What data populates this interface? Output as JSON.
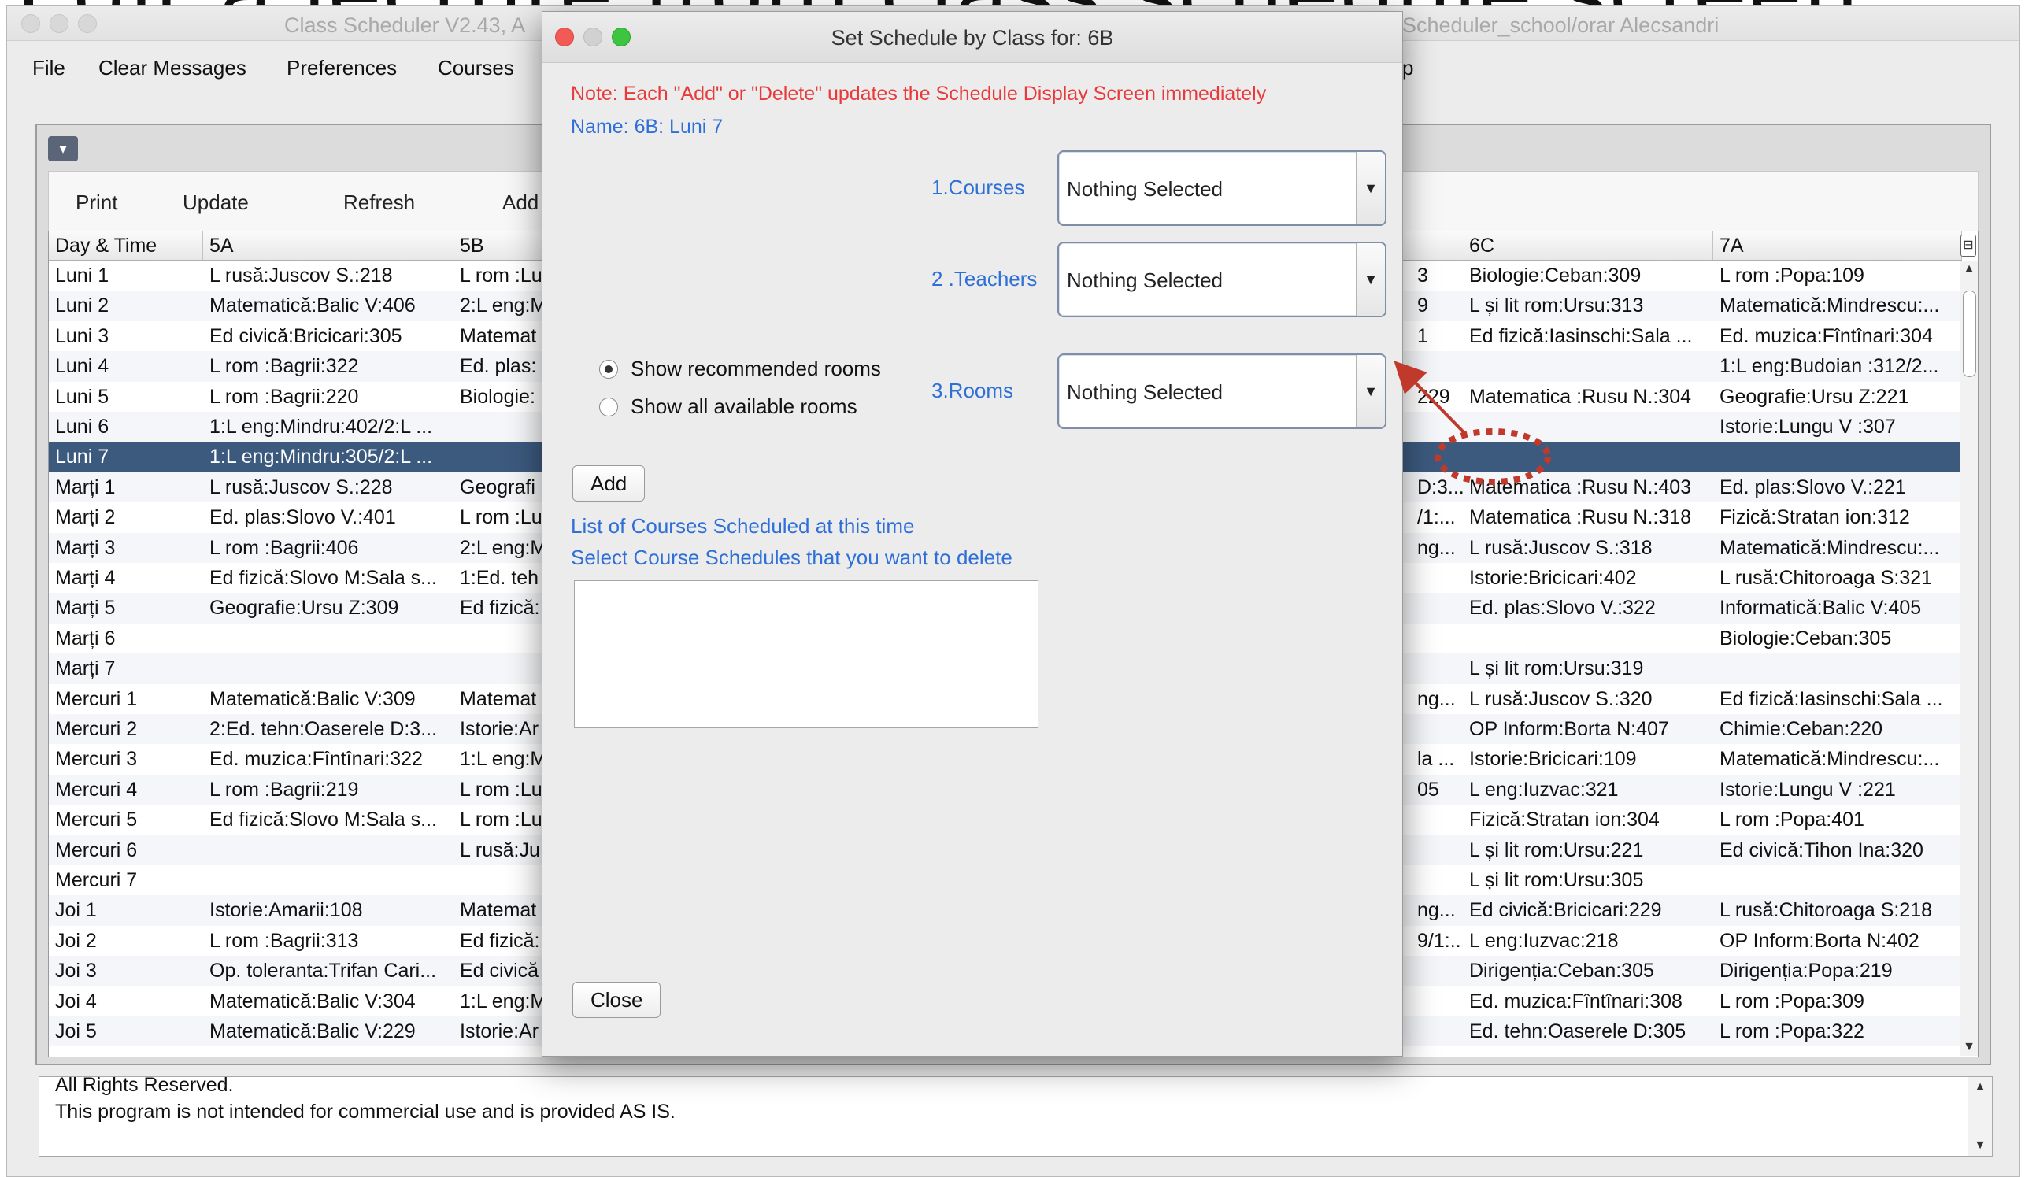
{
  "banner": {
    "text": "Edit a lecture from class schedule screen"
  },
  "window": {
    "title_left": "Class Scheduler V2.43, A",
    "title_right": "Scheduler_school/orar Alecsandri"
  },
  "menu": [
    "File",
    "Clear Messages",
    "Preferences",
    "Courses",
    "p"
  ],
  "toolbar": [
    "Print",
    "Update",
    "Refresh",
    "Add"
  ],
  "table": {
    "columns": [
      "Day & Time",
      "5A",
      "5B",
      "6C",
      "7A"
    ],
    "rows": [
      {
        "day": "Luni 1",
        "c5a": "L rusă:Juscov S.:218",
        "c5b": "L rom :Lu",
        "c6b": "3",
        "c6c": "Biologie:Ceban:309",
        "c7a": "L rom :Popa:109"
      },
      {
        "day": "Luni 2",
        "c5a": "Matematică:Balic V:406",
        "c5b": "2:L eng:M",
        "c6b": "9",
        "c6c": "L și lit rom:Ursu:313",
        "c7a": "Matematică:Mindrescu:..."
      },
      {
        "day": "Luni 3",
        "c5a": "Ed civică:Bricicari:305",
        "c5b": "Matemat",
        "c6b": "1",
        "c6c": "Ed fizică:Iasinschi:Sala ...",
        "c7a": "Ed. muzica:Fîntînari:304"
      },
      {
        "day": "Luni 4",
        "c5a": "L rom :Bagrii:322",
        "c5b": "Ed. plas:",
        "c6b": "",
        "c6c": "",
        "c7a": "1:L eng:Budoian :312/2..."
      },
      {
        "day": "Luni 5",
        "c5a": "L rom :Bagrii:220",
        "c5b": "Biologie:",
        "c6b": "229",
        "c6c": "Matematica :Rusu N.:304",
        "c7a": "Geografie:Ursu Z:221"
      },
      {
        "day": "Luni 6",
        "c5a": "1:L eng:Mindru:402/2:L ...",
        "c5b": "",
        "c6b": "",
        "c6c": "",
        "c7a": "Istorie:Lungu V :307"
      },
      {
        "day": "Luni 7",
        "c5a": "1:L eng:Mindru:305/2:L ...",
        "c5b": "",
        "c6b": "",
        "c6c": "",
        "c7a": ""
      },
      {
        "day": "Marți 1",
        "c5a": "L rusă:Juscov S.:228",
        "c5b": "Geografi",
        "c6b": "D:3...",
        "c6c": "Matematica :Rusu N.:403",
        "c7a": "Ed. plas:Slovo V.:221"
      },
      {
        "day": "Marți 2",
        "c5a": "Ed. plas:Slovo V.:401",
        "c5b": "L rom :Lu",
        "c6b": "/1:...",
        "c6c": "Matematica :Rusu N.:318",
        "c7a": "Fizică:Stratan ion:312"
      },
      {
        "day": "Marți 3",
        "c5a": "L rom :Bagrii:406",
        "c5b": "2:L eng:M",
        "c6b": "ng...",
        "c6c": "L rusă:Juscov S.:318",
        "c7a": "Matematică:Mindrescu:..."
      },
      {
        "day": "Marți 4",
        "c5a": "Ed fizică:Slovo M:Sala s...",
        "c5b": "1:Ed. teh",
        "c6b": "",
        "c6c": "Istorie:Bricicari:402",
        "c7a": "L rusă:Chitoroaga S:321"
      },
      {
        "day": "Marți 5",
        "c5a": "Geografie:Ursu Z:309",
        "c5b": "Ed fizică:",
        "c6b": "",
        "c6c": "Ed. plas:Slovo V.:322",
        "c7a": "Informatică:Balic V:405"
      },
      {
        "day": "Marți 6",
        "c5a": "",
        "c5b": "",
        "c6b": "",
        "c6c": "",
        "c7a": "Biologie:Ceban:305"
      },
      {
        "day": "Marți 7",
        "c5a": "",
        "c5b": "",
        "c6b": "",
        "c6c": "L și lit rom:Ursu:319",
        "c7a": ""
      },
      {
        "day": "Mercuri 1",
        "c5a": "Matematică:Balic V:309",
        "c5b": "Matemat",
        "c6b": "ng...",
        "c6c": "L rusă:Juscov S.:320",
        "c7a": "Ed fizică:Iasinschi:Sala ..."
      },
      {
        "day": "Mercuri 2",
        "c5a": "2:Ed. tehn:Oaserele D:3...",
        "c5b": "Istorie:Ar",
        "c6b": "",
        "c6c": "OP Inform:Borta N:407",
        "c7a": "Chimie:Ceban:220"
      },
      {
        "day": "Mercuri 3",
        "c5a": "Ed. muzica:Fîntînari:322",
        "c5b": "1:L eng:M",
        "c6b": "la ...",
        "c6c": "Istorie:Bricicari:109",
        "c7a": "Matematică:Mindrescu:..."
      },
      {
        "day": "Mercuri 4",
        "c5a": "L rom :Bagrii:219",
        "c5b": "L rom :Lu",
        "c6b": "05",
        "c6c": "L eng:Iuzvac:321",
        "c7a": "Istorie:Lungu V :221"
      },
      {
        "day": "Mercuri 5",
        "c5a": "Ed fizică:Slovo M:Sala s...",
        "c5b": "L rom :Lu",
        "c6b": "",
        "c6c": "Fizică:Stratan ion:304",
        "c7a": "L rom :Popa:401"
      },
      {
        "day": "Mercuri 6",
        "c5a": "",
        "c5b": "L rusă:Ju",
        "c6b": "",
        "c6c": "L și lit rom:Ursu:221",
        "c7a": "Ed civică:Tihon Ina:320"
      },
      {
        "day": "Mercuri 7",
        "c5a": "",
        "c5b": "",
        "c6b": "",
        "c6c": "L și lit rom:Ursu:305",
        "c7a": ""
      },
      {
        "day": "Joi 1",
        "c5a": "Istorie:Amarii:108",
        "c5b": "Matemat",
        "c6b": "ng...",
        "c6c": "Ed civică:Bricicari:229",
        "c7a": "L rusă:Chitoroaga S:218"
      },
      {
        "day": "Joi 2",
        "c5a": "L rom :Bagrii:313",
        "c5b": "Ed fizică:",
        "c6b": "9/1:...",
        "c6c": "L eng:Iuzvac:218",
        "c7a": "OP Inform:Borta N:402"
      },
      {
        "day": "Joi 3",
        "c5a": "Op. toleranta:Trifan Cari...",
        "c5b": "Ed civică",
        "c6b": "",
        "c6c": "Dirigenția:Ceban:305",
        "c7a": "Dirigenția:Popa:219"
      },
      {
        "day": "Joi 4",
        "c5a": "Matematică:Balic V:304",
        "c5b": "1:L eng:M",
        "c6b": "",
        "c6c": "Ed. muzica:Fîntînari:308",
        "c7a": "L rom :Popa:309"
      },
      {
        "day": "Joi 5",
        "c5a": "Matematică:Balic V:229",
        "c5b": "Istorie:Ar",
        "c6b": "",
        "c6c": "Ed. tehn:Oaserele D:305",
        "c7a": "L rom :Popa:322"
      }
    ]
  },
  "messages": {
    "line1": "All Rights Reserved.",
    "line2": "This program is not intended for commercial use and is provided AS IS."
  },
  "dialog": {
    "title": "Set Schedule by Class for: 6B",
    "note": "Note: Each \"Add\" or \"Delete\" updates the Schedule Display Screen immediately",
    "name": "Name: 6B: Luni 7",
    "courses_label": "1.Courses",
    "teachers_label": "2 .Teachers",
    "rooms_label": "3.Rooms",
    "courses_value": "Nothing Selected",
    "teachers_value": "Nothing Selected",
    "rooms_value": "Nothing Selected",
    "radio_recommended": "Show recommended rooms",
    "radio_all": "Show all available rooms",
    "radio_selected": "recommended",
    "add_label": "Add",
    "list_heading": "List of Courses Scheduled at this time",
    "list_instruction": "Select Course Schedules that you want to delete",
    "close_label": "Close"
  },
  "colors": {
    "note_red": "#e83a3a",
    "label_blue": "#2f6fd8",
    "selection": "#3c5a7e",
    "annotation": "#c0392b"
  },
  "icons": {
    "collapse": "chevron-down-icon",
    "combo_arrow": "triangle-down-icon",
    "corner": "column-control-icon"
  }
}
